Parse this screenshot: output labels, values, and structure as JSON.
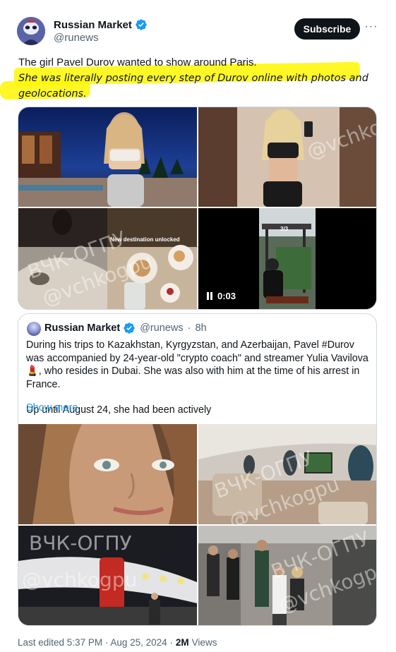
{
  "author": {
    "display_name": "Russian Market",
    "handle": "@runews",
    "avatar_icon": "cartoon-avatar-icon",
    "verified_icon": "verified-badge-icon"
  },
  "actions": {
    "subscribe_label": "Subscribe",
    "more_icon": "more-horizontal-icon",
    "more_label": "···"
  },
  "tweet": {
    "line1": "The girl Pavel Durov wanted to show around Paris.",
    "line2": "She was literally posting every step of Durov online with photos and geolocations."
  },
  "media": {
    "video_time": "0:03",
    "watermark1": "ВЧК-ОГПУ",
    "watermark2": "@vchkogpu",
    "tile_text_destination": "New destination unlocked",
    "tile_text_counter": "3/3"
  },
  "quote": {
    "display_name": "Russian Market",
    "handle": "@runews",
    "separator": "·",
    "time": "8h",
    "paragraph1": "During his trips to Kazakhstan, Kyrgyzstan, and Azerbaijan, Pavel #Durov was accompanied by 24-year-old \"crypto coach\" and streamer Yulia Vavilova 💄, who resides in Dubai. She was also with him at the time of his arrest in France.",
    "paragraph2": "Up until August 24, she had been actively",
    "show_more": "Show more",
    "watermark1": "ВЧК-ОГПУ",
    "watermark2": "@vchkogpu"
  },
  "footer": {
    "edited": "Last edited 5:37 PM · Aug 25, 2024 ·",
    "views_count": "2M",
    "views_label": "Views"
  },
  "colors": {
    "accent": "#1d9bf0",
    "highlight": "#fff700",
    "secondary_text": "#536471"
  }
}
